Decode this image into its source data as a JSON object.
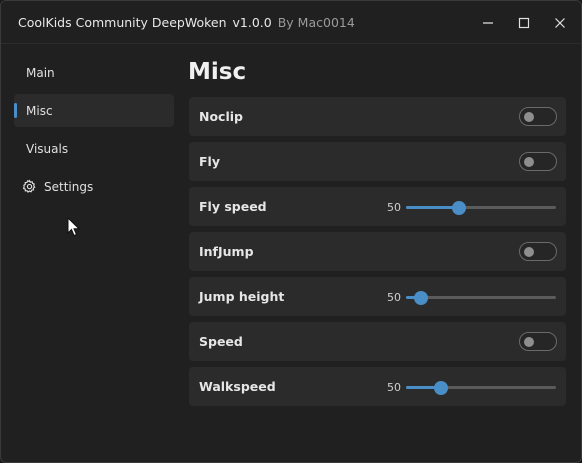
{
  "titlebar": {
    "app_name": "CoolKids Community DeepWoken",
    "version": "v1.0.0",
    "author": "By Mac0014"
  },
  "sidebar": {
    "items": [
      {
        "label": "Main",
        "active": false
      },
      {
        "label": "Misc",
        "active": true
      },
      {
        "label": "Visuals",
        "active": false
      },
      {
        "label": "Settings",
        "active": false,
        "icon": "gear-icon"
      }
    ]
  },
  "main": {
    "title": "Misc",
    "rows": [
      {
        "label": "Noclip",
        "type": "toggle",
        "value": false
      },
      {
        "label": "Fly",
        "type": "toggle",
        "value": false
      },
      {
        "label": "Fly speed",
        "type": "slider",
        "value": "50",
        "fraction": 0.35
      },
      {
        "label": "InfJump",
        "type": "toggle",
        "value": false
      },
      {
        "label": "Jump height",
        "type": "slider",
        "value": "50",
        "fraction": 0.1
      },
      {
        "label": "Speed",
        "type": "toggle",
        "value": false
      },
      {
        "label": "Walkspeed",
        "type": "slider",
        "value": "50",
        "fraction": 0.23
      }
    ]
  },
  "colors": {
    "accent": "#4a8ec7",
    "background": "#202020",
    "row_background": "#2b2b2b"
  }
}
